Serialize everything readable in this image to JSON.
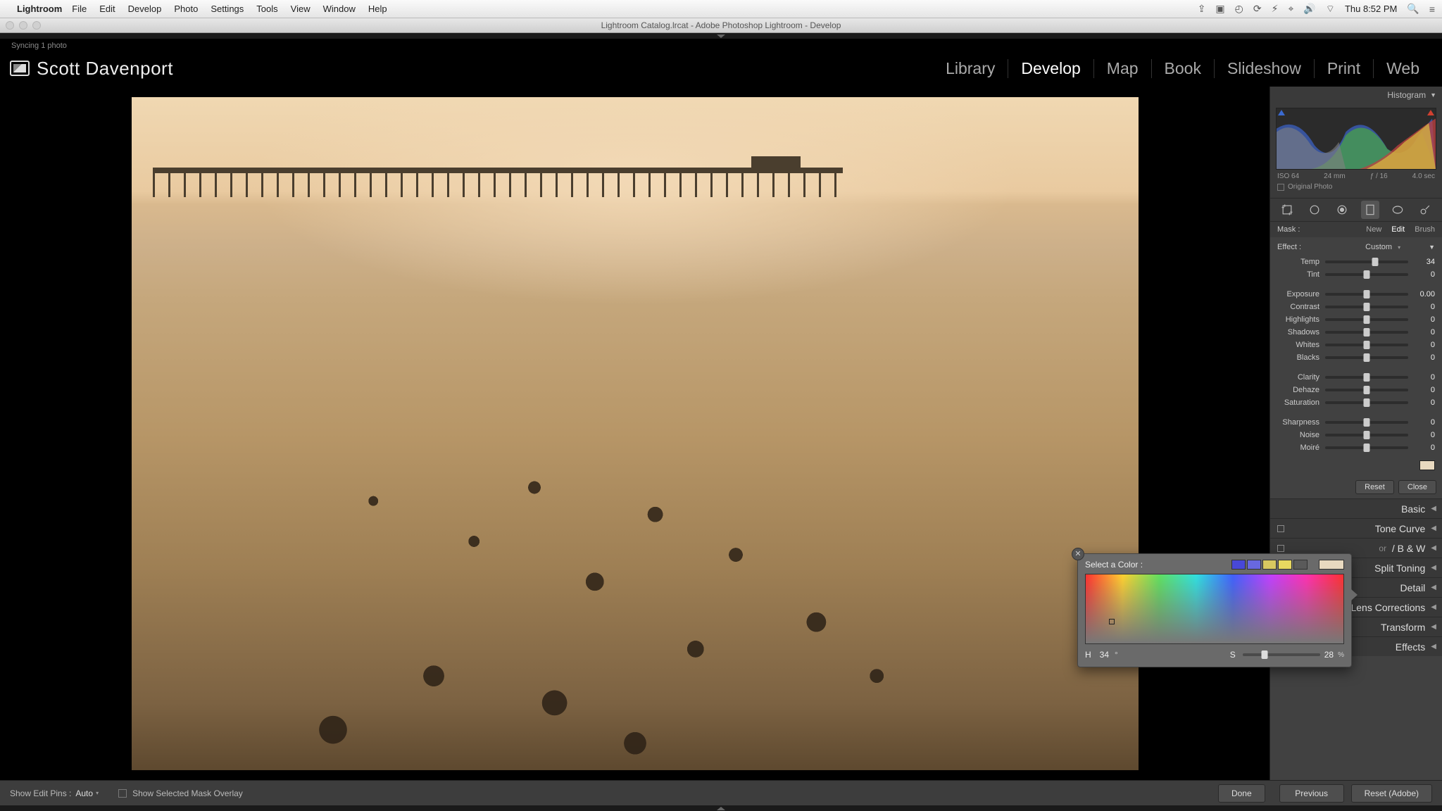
{
  "menubar": {
    "app": "Lightroom",
    "items": [
      "File",
      "Edit",
      "Develop",
      "Photo",
      "Settings",
      "Tools",
      "View",
      "Window",
      "Help"
    ],
    "clock": "Thu 8:52 PM"
  },
  "window_title": "Lightroom Catalog.lrcat - Adobe Photoshop Lightroom - Develop",
  "sync_status": "Syncing 1 photo",
  "identity": "Scott Davenport",
  "modules": [
    "Library",
    "Develop",
    "Map",
    "Book",
    "Slideshow",
    "Print",
    "Web"
  ],
  "active_module": "Develop",
  "histogram": {
    "title": "Histogram",
    "iso": "ISO 64",
    "focal": "24 mm",
    "aperture": "ƒ / 16",
    "shutter": "4.0 sec",
    "original_label": "Original Photo"
  },
  "mask": {
    "label": "Mask :",
    "options": [
      "New",
      "Edit",
      "Brush"
    ],
    "active": "Edit"
  },
  "effect": {
    "label": "Effect :",
    "value": "Custom"
  },
  "sliders": {
    "temp": {
      "label": "Temp",
      "value": "34",
      "pos": 60
    },
    "tint": {
      "label": "Tint",
      "value": "0",
      "pos": 50
    },
    "exposure": {
      "label": "Exposure",
      "value": "0.00",
      "pos": 50
    },
    "contrast": {
      "label": "Contrast",
      "value": "0",
      "pos": 50
    },
    "highlights": {
      "label": "Highlights",
      "value": "0",
      "pos": 50
    },
    "shadows": {
      "label": "Shadows",
      "value": "0",
      "pos": 50
    },
    "whites": {
      "label": "Whites",
      "value": "0",
      "pos": 50
    },
    "blacks": {
      "label": "Blacks",
      "value": "0",
      "pos": 50
    },
    "clarity": {
      "label": "Clarity",
      "value": "0",
      "pos": 50
    },
    "dehaze": {
      "label": "Dehaze",
      "value": "0",
      "pos": 50
    },
    "saturation": {
      "label": "Saturation",
      "value": "0",
      "pos": 50
    },
    "sharpness": {
      "label": "Sharpness",
      "value": "0",
      "pos": 50
    },
    "noise": {
      "label": "Noise",
      "value": "0",
      "pos": 50
    },
    "moire": {
      "label": "Moiré",
      "value": "0",
      "pos": 50
    }
  },
  "panel_buttons": {
    "reset": "Reset",
    "close": "Close"
  },
  "sections": {
    "basic": "Basic",
    "tone_curve": "Tone Curve",
    "hsl_bw": "/ B & W",
    "hsl_prefix": "or",
    "split_toning": "Split Toning",
    "detail": "Detail",
    "lens": "Lens Corrections",
    "transform": "Transform",
    "effects": "Effects"
  },
  "color_picker": {
    "title": "Select a Color :",
    "hue_label": "H",
    "hue": "34",
    "sat_label": "S",
    "sat": "28",
    "preset_colors": [
      "#4848d8",
      "#6868e0",
      "#d8c860",
      "#e8d860",
      "#5a5a5a"
    ],
    "current": "#e8d9c0"
  },
  "toolbar": {
    "pins_label": "Show Edit Pins :",
    "pins_value": "Auto",
    "mask_label": "Show Selected Mask Overlay",
    "done": "Done",
    "previous": "Previous",
    "reset": "Reset (Adobe)"
  }
}
